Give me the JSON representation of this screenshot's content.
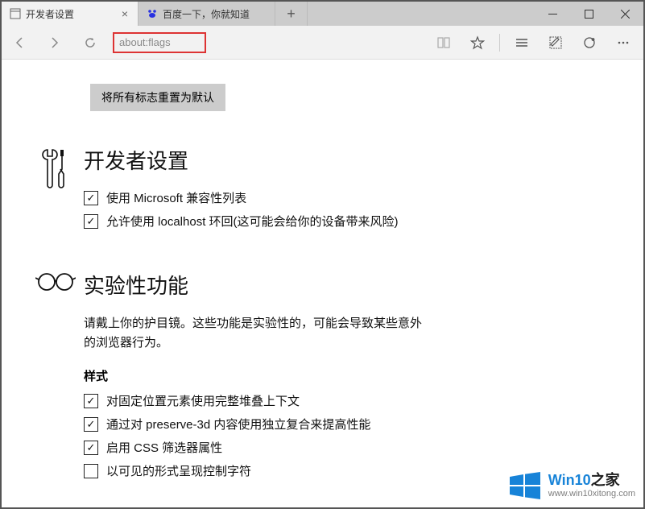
{
  "tabs": [
    {
      "label": "开发者设置",
      "active": true
    },
    {
      "label": "百度一下，你就知道",
      "active": false
    }
  ],
  "address_bar": {
    "value": "about:flags"
  },
  "reset_button": "将所有标志重置为默认",
  "sections": {
    "developer": {
      "title": "开发者设置",
      "options": [
        {
          "label": "使用 Microsoft 兼容性列表",
          "checked": true
        },
        {
          "label": "允许使用 localhost 环回(这可能会给你的设备带来风险)",
          "checked": true
        }
      ]
    },
    "experimental": {
      "title": "实验性功能",
      "description": "请戴上你的护目镜。这些功能是实验性的，可能会导致某些意外的浏览器行为。",
      "sub_heading": "样式",
      "options": [
        {
          "label": "对固定位置元素使用完整堆叠上下文",
          "checked": true
        },
        {
          "label": "通过对 preserve-3d 内容使用独立复合来提高性能",
          "checked": true
        },
        {
          "label": "启用 CSS 筛选器属性",
          "checked": true
        },
        {
          "label": "以可见的形式呈现控制字符",
          "checked": false
        }
      ]
    }
  },
  "watermark": {
    "brand_main": "Win10",
    "brand_suffix": "之家",
    "url": "www.win10xitong.com"
  }
}
